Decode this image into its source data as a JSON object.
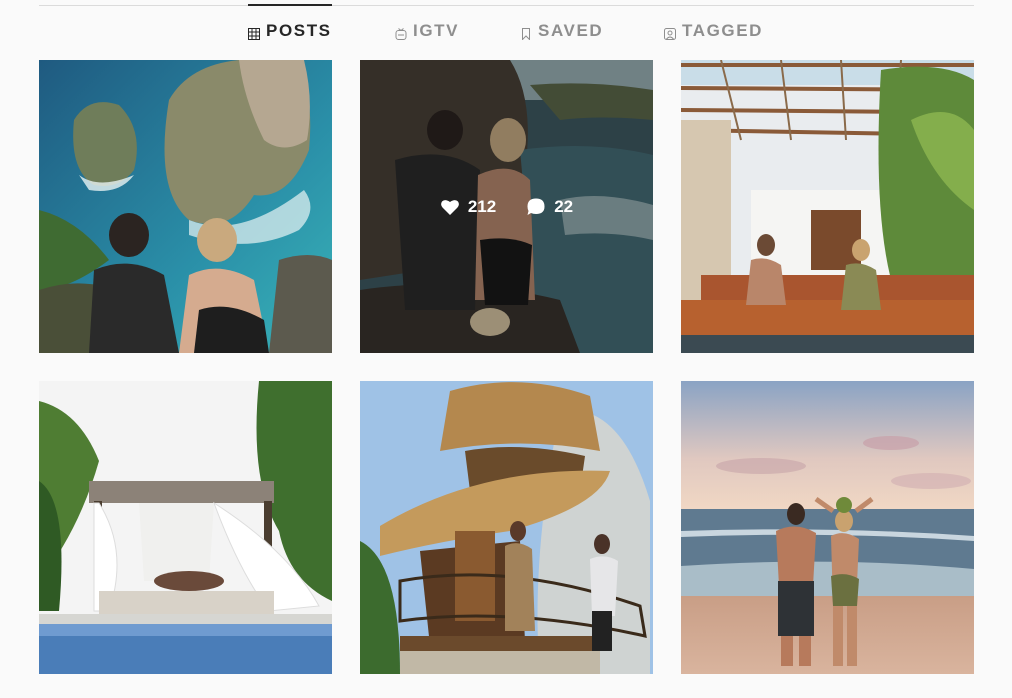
{
  "tabs": [
    {
      "label": "POSTS",
      "icon": "grid-icon",
      "active": true
    },
    {
      "label": "IGTV",
      "icon": "igtv-icon",
      "active": false
    },
    {
      "label": "SAVED",
      "icon": "bookmark-icon",
      "active": false
    },
    {
      "label": "TAGGED",
      "icon": "tag-icon",
      "active": false
    }
  ],
  "posts": [
    {
      "scene": "couple on cliff above turquoise sea"
    },
    {
      "scene": "couple embracing on rocks by the ocean",
      "hover": {
        "likes": "212",
        "comments": "22"
      }
    },
    {
      "scene": "couple on wooden deck under pergola"
    },
    {
      "scene": "couple in white cabana beside pool"
    },
    {
      "scene": "couple on thatched bamboo treehouse"
    },
    {
      "scene": "couple on beach at sunset"
    }
  ],
  "colors": {
    "active_tab": "#262626",
    "inactive_tab": "#8e8e8e",
    "background": "#fafafa",
    "divider": "#dbdbdb"
  }
}
